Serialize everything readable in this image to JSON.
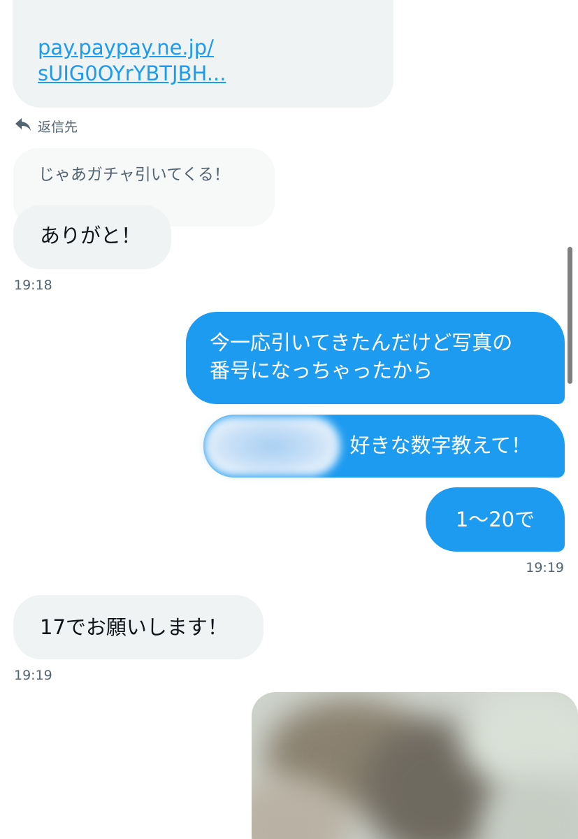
{
  "link_message": {
    "line1": "pay.paypay.ne.jp/",
    "line2": "sUIG0OYrYBTJBH..."
  },
  "reply": {
    "label": "返信先",
    "icon": "reply-arrow-icon"
  },
  "quoted_message": "じゃあガチャ引いてくる！",
  "messages_incoming": [
    {
      "text": "ありがと！",
      "timestamp": "19:18"
    },
    {
      "text": "17でお願いします！",
      "timestamp": "19:19"
    }
  ],
  "messages_outgoing": [
    {
      "text_line1": "今一応引いてきたんだけど写真の",
      "text_line2": "番号になっちゃったから"
    },
    {
      "text": "好きな数字教えて！"
    },
    {
      "text": "1〜20で"
    }
  ],
  "outgoing_timestamp": "19:19",
  "colors": {
    "outgoing_bubble": "#1d9bf0",
    "incoming_bubble": "#eff3f4",
    "link": "#1d9bf0",
    "timestamp": "#536471"
  }
}
